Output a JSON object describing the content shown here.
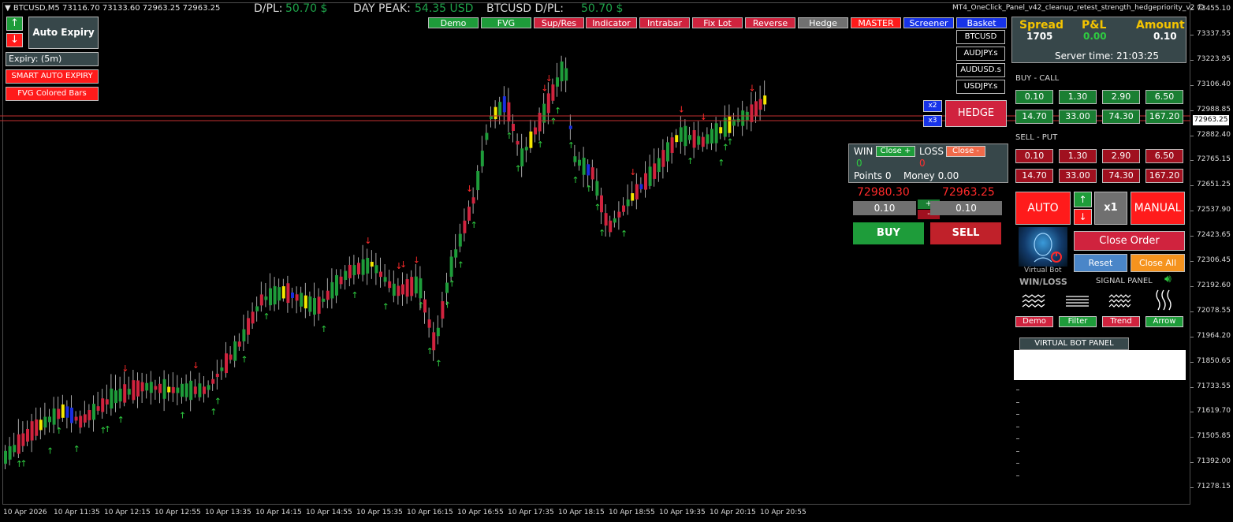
{
  "header": {
    "symbol_info": "BTCUSD,M5  73116.70 73133.60 72963.25 72963.25",
    "dpl_label": "D/PL:",
    "dpl_value": "50.70 $",
    "peak_label": "DAY PEAK:",
    "peak_value": "54.35 USD",
    "sym_dpl_label": "BTCUSD D/PL:",
    "sym_dpl_value": "50.70 $",
    "ea_name": "MT4_OneClick_Panel_v42_cleanup_retest_strength_hedgepriority_v2",
    "smiley": "☺"
  },
  "left_panel": {
    "up_arrow": "↑",
    "down_arrow": "↓",
    "auto_expiry": "Auto Expiry",
    "expiry": "Expiry: (5m)",
    "smart_auto_expiry": "SMART AUTO EXPIRY",
    "fvg_colored_bars": "FVG Colored Bars"
  },
  "toolbar": [
    "Demo",
    "FVG",
    "Sup/Res",
    "Indicator",
    "Intrabar",
    "Fix Lot",
    "Reverse",
    "Hedge",
    "MASTER",
    "Screener",
    "Basket"
  ],
  "toolbar_colors": [
    "#1e9c3a",
    "#1e9c3a",
    "#d0233e",
    "#d0233e",
    "#d0233e",
    "#d0233e",
    "#d0233e",
    "#707070",
    "#ff1b1b",
    "#1733e8",
    "#1733e8"
  ],
  "symbols": [
    "BTCUSD",
    "AUDJPY.s",
    "AUDUSD.s",
    "USDJPY.s"
  ],
  "hedge": {
    "x2": "x2",
    "x3": "x3",
    "label": "HEDGE"
  },
  "winloss": {
    "win": "WIN",
    "close_plus": "Close +",
    "loss": "LOSS",
    "close_minus": "Close -",
    "win_count": "0",
    "loss_count": "0",
    "points": "Points 0",
    "money": "Money 0.00"
  },
  "trade": {
    "price_buy": "72980.30",
    "price_sell": "72963.25",
    "lot_left": "0.10",
    "lot_right": "0.10",
    "plus": "+",
    "minus": "-",
    "buy": "BUY",
    "sell": "SELL"
  },
  "info": {
    "spread_label": "Spread",
    "spread_value": "1705",
    "pl_label": "P&L",
    "pl_value": "0.00",
    "amount_label": "Amount",
    "amount_value": "0.10",
    "server_time": "Server time: 21:03:25"
  },
  "buy_call": {
    "label": "BUY - CALL",
    "values": [
      "0.10",
      "1.30",
      "2.90",
      "6.50",
      "14.70",
      "33.00",
      "74.30",
      "167.20"
    ]
  },
  "sell_put": {
    "label": "SELL - PUT",
    "values": [
      "0.10",
      "1.30",
      "2.90",
      "6.50",
      "14.70",
      "33.00",
      "74.30",
      "167.20"
    ]
  },
  "controls": {
    "auto": "AUTO",
    "manual": "MANUAL",
    "x1": "x1",
    "up": "↑",
    "down": "↓",
    "virtual_bot": "Virtual Bot",
    "close_order": "Close Order",
    "reset": "Reset",
    "close_all": "Close All",
    "win_loss": "WIN/LOSS",
    "signal_panel": "SIGNAL PANEL",
    "filters": [
      "Demo",
      "Filter",
      "Trend",
      "Arrow"
    ],
    "virtual_bot_panel": "VIRTUAL BOT PANEL"
  },
  "price_axis": [
    "73455.10",
    "73337.55",
    "73223.95",
    "73106.40",
    "72988.85",
    "72882.40",
    "72765.15",
    "72651.25",
    "72537.90",
    "72423.65",
    "72306.45",
    "72192.60",
    "72078.55",
    "71964.20",
    "71850.65",
    "71733.55",
    "71619.70",
    "71505.85",
    "71392.00",
    "71278.15"
  ],
  "current_price": "72963.25",
  "time_axis": [
    "10 Apr 2026",
    "10 Apr 11:35",
    "10 Apr 12:15",
    "10 Apr 12:55",
    "10 Apr 13:35",
    "10 Apr 14:15",
    "10 Apr 14:55",
    "10 Apr 15:35",
    "10 Apr 16:15",
    "10 Apr 16:55",
    "10 Apr 17:35",
    "10 Apr 18:15",
    "10 Apr 18:55",
    "10 Apr 19:35",
    "10 Apr 20:15",
    "10 Apr 20:55"
  ]
}
